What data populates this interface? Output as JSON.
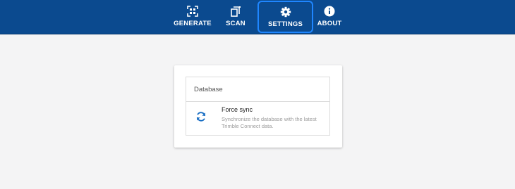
{
  "nav": {
    "tabs": [
      {
        "label": "GENERATE",
        "icon": "qr-code-icon"
      },
      {
        "label": "SCAN",
        "icon": "scan-icon"
      },
      {
        "label": "SETTINGS",
        "icon": "gear-icon",
        "active": true
      },
      {
        "label": "ABOUT",
        "icon": "info-icon"
      }
    ]
  },
  "settings": {
    "section_title": "Database",
    "item": {
      "title": "Force sync",
      "description": "Synchronize the database with the latest Trimble Connect data.",
      "icon": "sync-icon"
    }
  },
  "colors": {
    "topbar": "#0b4a8f",
    "active_outline": "#1f86ff",
    "icon_blue": "#1a6fc4"
  }
}
